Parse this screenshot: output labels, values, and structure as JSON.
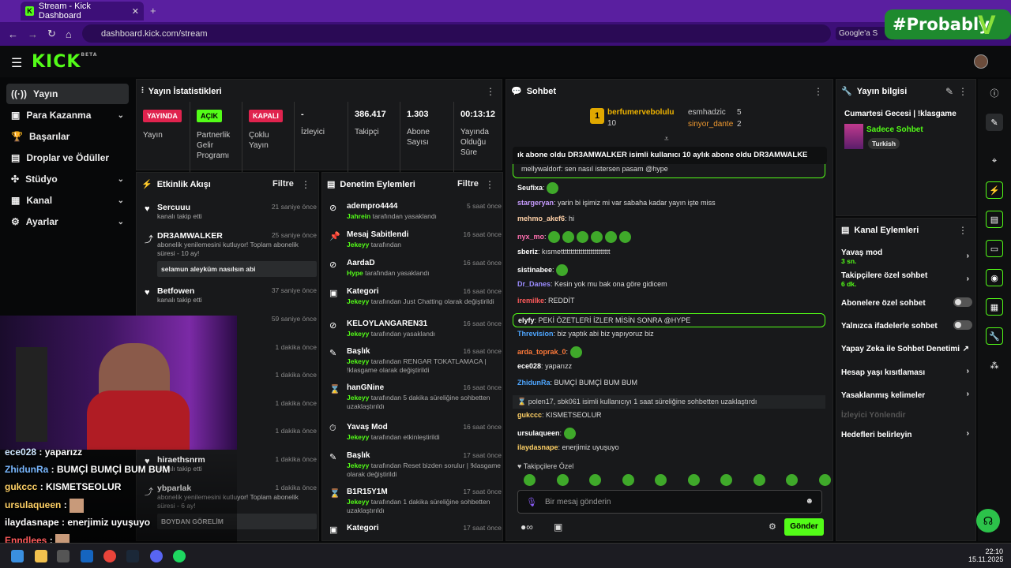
{
  "browser": {
    "tab_title": "Stream - Kick Dashboard",
    "url": "dashboard.kick.com/stream",
    "google_chip": "Google'a S"
  },
  "overlay": {
    "badge": "#Probably"
  },
  "sidebar": {
    "items": [
      {
        "label": "Yayın"
      },
      {
        "label": "Para Kazanma"
      },
      {
        "label": "Başarılar"
      },
      {
        "label": "Droplar ve Ödüller"
      },
      {
        "label": "Stüdyo"
      },
      {
        "label": "Kanal"
      },
      {
        "label": "Ayarlar"
      }
    ]
  },
  "stats": {
    "title": "Yayın İstatistikleri",
    "cells": [
      {
        "pill": "YAYINDA",
        "label": "Yayın"
      },
      {
        "pill": "AÇIK",
        "label": "Partnerlik Gelir Programı"
      },
      {
        "pill": "KAPALI",
        "label": "Çoklu Yayın"
      },
      {
        "value": "-",
        "label": "İzleyici"
      },
      {
        "value": "386.417",
        "label": "Takipçi"
      },
      {
        "value": "1.303",
        "label": "Abone Sayısı"
      },
      {
        "value": "00:13:12",
        "label": "Yayında Olduğu Süre"
      }
    ]
  },
  "activity": {
    "title": "Etkinlik Akışı",
    "filter": "Filtre",
    "items": [
      {
        "name": "Sercuuu",
        "sub": "kanalı takip etti",
        "time": "21 saniye önce"
      },
      {
        "name": "DR3AMWALKER",
        "sub": "abonelik yenilemesini kutluyor! Toplam abonelik süresi - 10 ay!",
        "time": "25 saniye önce",
        "quote": "selamun aleyküm nasılsın abi"
      },
      {
        "name": "Betfowen",
        "sub": "kanalı takip etti",
        "time": "37 saniye önce"
      },
      {
        "time": "59 saniye önce"
      },
      {
        "time": "1 dakika önce"
      },
      {
        "time": "1 dakika önce"
      },
      {
        "time": "1 dakika önce"
      },
      {
        "time": "1 dakika önce"
      },
      {
        "name": "hiraethsnrm",
        "sub": "kanalı takip etti",
        "time": "1 dakika önce"
      },
      {
        "name": "ybparlak",
        "sub": "abonelik yenilemesini kutluyor! Toplam abonelik süresi - 6 ay!",
        "time": "1 dakika önce",
        "quote": "BOYDAN GÖRELİM"
      }
    ]
  },
  "modlog": {
    "title": "Denetim Eylemleri",
    "filter": "Filtre",
    "items": [
      {
        "name": "adempro4444",
        "actor": "Jahrein",
        "rest": "tarafından yasaklandı",
        "time": "5 saat önce"
      },
      {
        "name": "Mesaj Sabitlendi",
        "actor": "Jekeyy",
        "rest": "tarafından",
        "time": "16 saat önce"
      },
      {
        "name": "AardaD",
        "actor": "Hype",
        "rest": "tarafından yasaklandı",
        "time": "16 saat önce"
      },
      {
        "name": "Kategori",
        "actor": "Jekeyy",
        "rest": "tarafından Just Chatting olarak değiştirildi",
        "time": "16 saat önce"
      },
      {
        "name": "KELOYLANGAREN31",
        "actor": "Jekeyy",
        "rest": "tarafından yasaklandı",
        "time": "16 saat önce"
      },
      {
        "name": "Başlık",
        "actor": "Jekeyy",
        "rest": "tarafından RENGAR TOKATLAMACA | !klasgame olarak değiştirildi",
        "time": "16 saat önce"
      },
      {
        "name": "hanGNine",
        "actor": "Jekeyy",
        "rest": "tarafından 5 dakika süreliğine sohbetten uzaklaştırıldı",
        "time": "16 saat önce"
      },
      {
        "name": "Yavaş Mod",
        "actor": "Jekeyy",
        "rest": "tarafından etkinleştirildi",
        "time": "16 saat önce"
      },
      {
        "name": "Başlık",
        "actor": "Jekeyy",
        "rest": "tarafından Reset bizden sorulur | !klasgame olarak değiştirildi",
        "time": "17 saat önce"
      },
      {
        "name": "B1R15Y1M",
        "actor": "Jekeyy",
        "rest": "tarafından 1 dakika süreliğine sohbetten uzaklaştırıldı",
        "time": "17 saat önce"
      },
      {
        "name": "Kategori",
        "time": "17 saat önce"
      }
    ]
  },
  "chat": {
    "title": "Sohbet",
    "top": [
      {
        "name": "berfumervebolulu",
        "count": "10"
      },
      {
        "name": "esmhadzic",
        "count": "5"
      },
      {
        "name": "sinyor_dante",
        "count": "2"
      }
    ],
    "ticker": "ık abone oldu   DR3AMWALKER isimli kullanıcı 10 aylık abone oldu   DR3AMWALKE",
    "pinned": "mellywaldorf: sen nasıl istersen pasam @hype",
    "messages": [
      {
        "user": "Seufixa",
        "text": ""
      },
      {
        "user": "stargeryan",
        "text": "yarin bi işimiz mi var sabaha kadar yayın işte miss"
      },
      {
        "user": "mehmo_akef6",
        "text": "hi"
      },
      {
        "user": "nyx_mo",
        "text": ""
      },
      {
        "user": "sberiz",
        "text": "kısmettttttttttttttttttttttttt"
      },
      {
        "user": "sistinabee",
        "text": ""
      },
      {
        "user": "Dr_Danes",
        "text": "Kesin yok mu bak ona göre gidicem"
      },
      {
        "user": "iremilke",
        "text": "REDDİT"
      },
      {
        "user": "elyfy",
        "text": "PEKİ ÖZETLERİ İZLER MİSİN SONRA @HYPE"
      },
      {
        "user": "Threvision",
        "text": "biz yaptık abi biz yapıyoruz biz"
      },
      {
        "user": "arda_toprak_0",
        "text": ""
      },
      {
        "user": "ece028",
        "text": "yaparızz"
      },
      {
        "user": "ZhidunRa",
        "text": "BUMÇİ BUMÇİ BUM BUM"
      },
      {
        "user": "system",
        "text": "polen17, sbk061 isimli kullanıcıyı 1 saat süreliğine sohbetten uzaklaştırdı"
      },
      {
        "user": "gukccc",
        "text": "KISMETSEOLUR"
      },
      {
        "user": "ursulaqueen",
        "text": ""
      },
      {
        "user": "ilaydasnape",
        "text": "enerjimiz uyuşuyo"
      }
    ],
    "mode_label": "Takipçilere Özel",
    "input_placeholder": "Bir mesaj gönderin",
    "send": "Gönder"
  },
  "info": {
    "title": "Yayın bilgisi",
    "stream_title": "Cumartesi Gecesi | !klasgame",
    "category": "Sadece Sohbet",
    "tag": "Turkish"
  },
  "actions": {
    "title": "Kanal Eylemleri",
    "rows": [
      {
        "label": "Yavaş mod",
        "sub": "3 sn."
      },
      {
        "label": "Takipçilere özel sohbet",
        "sub": "6 dk."
      },
      {
        "label": "Abonelere özel sohbet"
      },
      {
        "label": "Yalnızca ifadelerle sohbet"
      },
      {
        "label": "Yapay Zeka ile Sohbet Denetimi"
      },
      {
        "label": "Hesap yaşı kısıtlaması"
      },
      {
        "label": "Yasaklanmış kelimeler"
      },
      {
        "label": "İzleyici Yönlendir"
      },
      {
        "label": "Hedefleri belirleyin"
      }
    ]
  },
  "webcam_overlay": {
    "lines": [
      {
        "user": "ece028",
        "text": "yaparızz"
      },
      {
        "user": "ZhidunRa",
        "text": "BUMÇİ BUMÇİ BUM BUM"
      },
      {
        "user": "gukccc",
        "text": "KISMETSEOLUR"
      },
      {
        "user": "ursulaqueen",
        "text": ""
      },
      {
        "user": "ilaydasnape",
        "text": "enerjimiz uyuşuyo"
      },
      {
        "user": "Enndlees",
        "text": ""
      }
    ]
  },
  "taskbar": {
    "time": "22:10",
    "date": "15.11.2025"
  },
  "colors": {
    "accent": "#53fc18",
    "panel": "#18191b",
    "browser": "#5a1fa0"
  }
}
